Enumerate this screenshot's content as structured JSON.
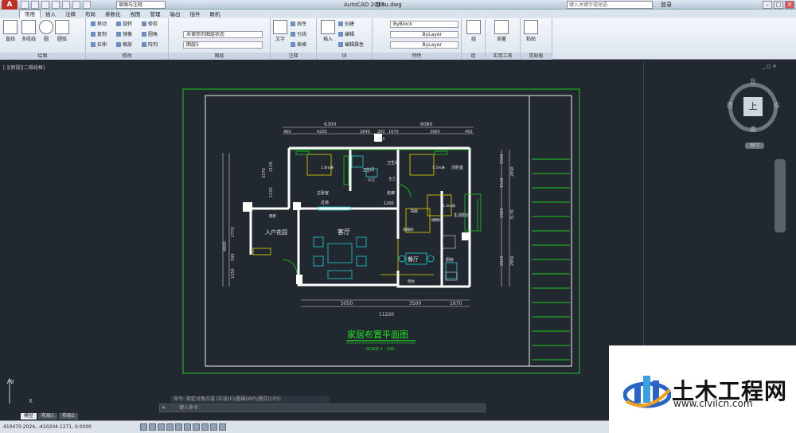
{
  "window": {
    "app_title": "AutoCAD 2013",
    "file_title": "新hu.dwg",
    "workspace": "草图与注释",
    "search_placeholder": "键入关键字或短语",
    "login": "登录",
    "minimize": "–",
    "maximize": "□",
    "close": "✕"
  },
  "ribbon_tabs": [
    "常用",
    "插入",
    "注释",
    "布局",
    "参数化",
    "视图",
    "管理",
    "输出",
    "插件",
    "联机"
  ],
  "panels": {
    "draw": {
      "title": "绘图",
      "line": "直线",
      "polyline": "多段线",
      "circle": "圆",
      "arc": "圆弧"
    },
    "modify": {
      "title": "修改",
      "move": "移动",
      "rotate": "旋转",
      "trim": "修剪",
      "copy": "复制",
      "mirror": "镜像",
      "fillet": "圆角",
      "stretch": "拉伸",
      "scale": "缩放",
      "array": "阵列"
    },
    "layers": {
      "title": "图层",
      "state": "未保存的图层状态",
      "current": "图层5"
    },
    "annotation": {
      "title": "注释",
      "text": "文字",
      "linear": "线性",
      "leader": "引线",
      "table": "表格"
    },
    "block": {
      "title": "块",
      "insert": "插入",
      "create": "创建",
      "edit": "编辑",
      "edit_attr": "编辑属性"
    },
    "properties": {
      "title": "特性",
      "color": "ByBlock",
      "linetype": "ByLayer",
      "lineweight": "ByLayer"
    },
    "groups": {
      "title": "组",
      "group": "组"
    },
    "utilities": {
      "title": "实用工具",
      "measure": "测量"
    },
    "clipboard": {
      "title": "剪贴板",
      "paste": "粘贴"
    }
  },
  "viewport_label": "[-][俯视][二维线框]",
  "viewport_controls": "_ □ ✕",
  "drawing": {
    "title": "家居布置平面图",
    "scale": "SCALE  1 : 100",
    "top_dims": [
      "6300",
      "6080"
    ],
    "top_sub_dims": [
      "460",
      "4200",
      "1640",
      "280",
      "1670",
      "3960",
      "450"
    ],
    "top_dim_mid": "280",
    "bottom_dims": [
      "5050",
      "3500",
      "1670"
    ],
    "bottom_total": "11220",
    "left_dims": [
      "3370",
      "2150",
      "1220",
      "2770",
      "4800",
      "590",
      "1550"
    ],
    "right_dims": [
      "1500",
      "1520",
      "2800",
      "2900",
      "3170",
      "2020",
      "2900"
    ],
    "rooms": {
      "living": "客厅",
      "dining": "餐厅",
      "entry": "入户花园",
      "master": "主卧室",
      "bath1": "卫生间",
      "bath2": "卫生间",
      "bedroom": "次卧室",
      "kitchen": "厨房",
      "study": "书房",
      "balcony": "生活阳台",
      "bed_label": "1.8m床",
      "bed_label2": "1.5m床",
      "bed_label3": "1.5m床",
      "corridor": "走廊",
      "hall": "过道",
      "storage": "储物间",
      "ptA": "公卫",
      "ptB": "主卫",
      "wardrobe": "衣帽间",
      "bar": "吧台",
      "shoe": "鞋柜",
      "dim1200": "1200"
    }
  },
  "viewcube": {
    "north": "北",
    "south": "南",
    "west": "西",
    "east": "东",
    "top": "上",
    "wcs": "WCS"
  },
  "command": {
    "history": "命令: 指定对角点或 [栏选(F)/圈围(WP)/圈交(CP)]:",
    "prompt": "键入命令",
    "close": "✕"
  },
  "model_tabs": [
    "模型",
    "布局1",
    "布局2"
  ],
  "status": {
    "coords": "410470.2024, -410204.1271, 0.0000"
  },
  "watermark": {
    "name": "土木工程网",
    "url": "www.civilcn.com"
  },
  "colors": {
    "frame_green": "#20c820",
    "wall_white": "#ffffff",
    "title_green": "#22e022",
    "dim_color": "#d8d8d8",
    "yellow": "#e8d800",
    "cyan": "#22d0d8",
    "canvas": "#212830"
  }
}
